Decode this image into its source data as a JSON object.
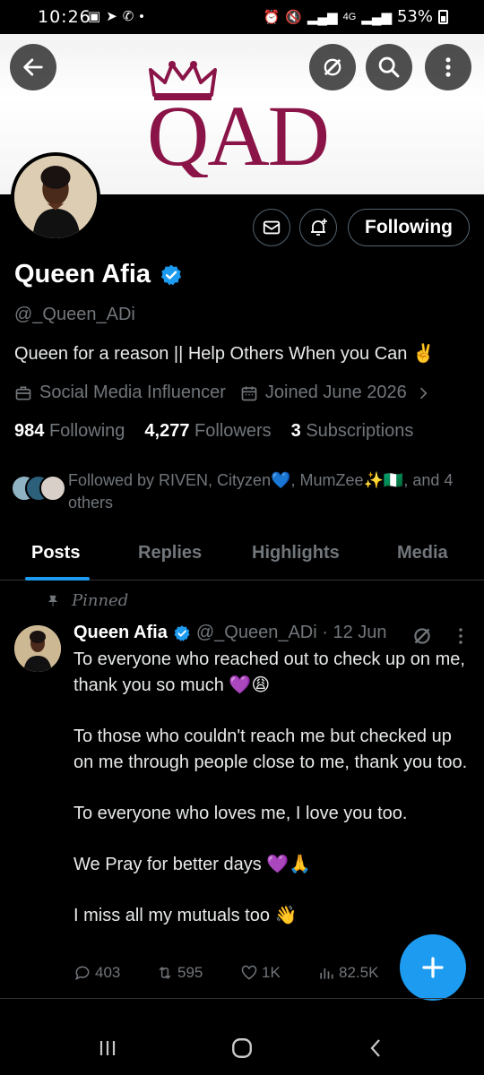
{
  "status_bar": {
    "time": "10:26",
    "network": "4G",
    "battery": "53%"
  },
  "banner": {
    "logo_text": "QAD",
    "brand_color": "#8a1447"
  },
  "profile": {
    "display_name": "Queen Afia",
    "handle": "@_Queen_ADi",
    "bio": "Queen for a reason || Help Others When you Can ✌️",
    "category": "Social Media Influencer",
    "joined": "Joined June 2026",
    "following_count": "984",
    "following_label": "Following",
    "followers_count": "4,277",
    "followers_label": "Followers",
    "subs_count": "3",
    "subs_label": "Subscriptions",
    "follow_button": "Following",
    "followed_by": "Followed by RIVEN, Cityzen💙, MumZee✨🇳🇬, and 4 others",
    "accent": "#1d9bf0"
  },
  "tabs": [
    "Posts",
    "Replies",
    "Highlights",
    "Media"
  ],
  "tweet": {
    "pinned_label": "Pinned",
    "name": "Queen Afia",
    "handle_date": "@_Queen_ADi · 12 Jun",
    "paragraphs": [
      "To everyone who reached out to check up on me, thank you so much 💜😩",
      "To those who couldn't reach me but checked up on me through people close to me, thank you too.",
      "To everyone who loves me, I love you too.",
      "We Pray for better days 💜🙏",
      "I miss all my mutuals too 👋"
    ],
    "replies": "403",
    "reposts": "595",
    "likes": "1K",
    "views": "82.5K"
  }
}
